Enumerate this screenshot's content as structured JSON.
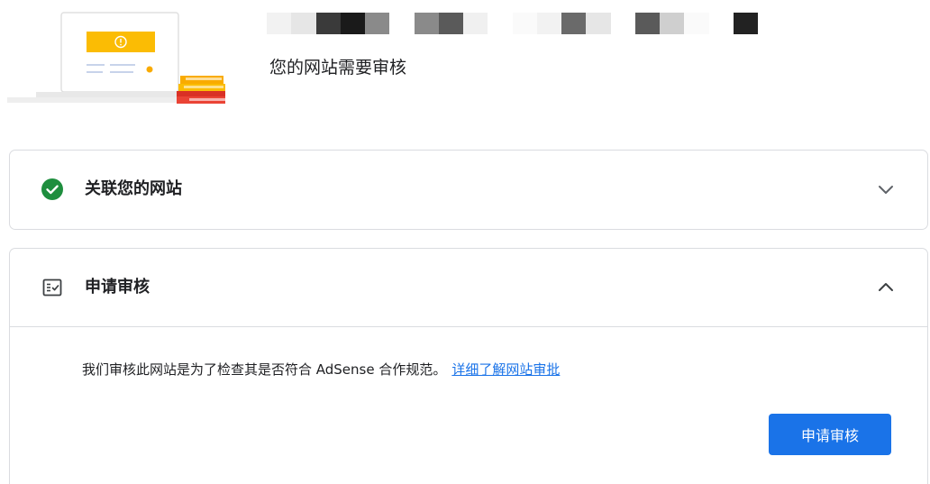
{
  "header": {
    "title": "您的网站需要审核",
    "redacted_site_name_colors": [
      "#f2f2f2",
      "#e6e6e6",
      "#3a3a3a",
      "#1a1a1a",
      "#8a8a8a",
      "#ffffff",
      "#8a8a8a",
      "#5a5a5a",
      "#f0f0f0",
      "#ffffff",
      "#fafafa",
      "#f2f2f2",
      "#6a6a6a",
      "#e6e6e6",
      "#ffffff",
      "#5a5a5a",
      "#cfcfcf",
      "#fafafa",
      "#ffffff",
      "#222222"
    ]
  },
  "sections": [
    {
      "title": "关联您的网站",
      "status_icon": "check-circle-icon",
      "status_color": "#1e8e3e",
      "expanded": false,
      "chevron_icon": "chevron-down-icon"
    },
    {
      "title": "申请审核",
      "status_icon": "checklist-icon",
      "expanded": true,
      "chevron_icon": "chevron-up-icon",
      "body_text": "我们审核此网站是为了检查其是否符合 AdSense 合作规范。",
      "link_text": "详细了解网站审批",
      "button_label": "申请审核"
    }
  ],
  "colors": {
    "accent": "#1a73e8",
    "success": "#1e8e3e",
    "warning": "#f9ab00",
    "border": "#dadce0"
  }
}
